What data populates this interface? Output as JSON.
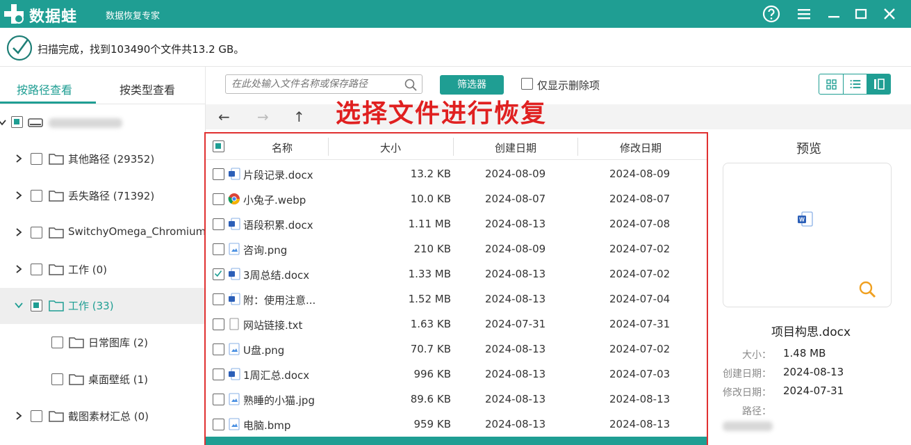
{
  "titlebar": {
    "app_name": "数据蛙",
    "app_subtitle": "数据恢复专家",
    "buttons": [
      "help-icon",
      "menu-icon",
      "minimize-icon",
      "maximize-icon",
      "close-icon"
    ]
  },
  "status": {
    "text": "扫描完成，找到103490个文件共13.2 GB。"
  },
  "left_tabs": {
    "by_path": "按路径查看",
    "by_type": "按类型查看"
  },
  "tree": [
    {
      "label": "其他路径 (29352)"
    },
    {
      "label": "丢失路径 (71392)"
    },
    {
      "label": "SwitchyOmega_Chromium"
    },
    {
      "label": "工作 (0)"
    },
    {
      "label": "工作 (33)"
    },
    {
      "label": "日常图库 (2)"
    },
    {
      "label": "桌面壁纸 (1)"
    },
    {
      "label": "截图素材汇总 (0)"
    }
  ],
  "toolbar": {
    "search_placeholder": "在此处输入文件名称或保存路径",
    "filter_label": "筛选器",
    "only_deleted_label": "仅显示删除项"
  },
  "annotation": "选择文件进行恢复",
  "table": {
    "headers": [
      "名称",
      "大小",
      "创建日期",
      "修改日期"
    ],
    "rows": [
      {
        "name": "片段记录.docx",
        "size": "13.2 KB",
        "created": "2024-08-09",
        "modified": "2024-08-09",
        "icon": "docx",
        "checked": false
      },
      {
        "name": "小兔子.webp",
        "size": "10.0 KB",
        "created": "2024-08-07",
        "modified": "2024-08-07",
        "icon": "chrome",
        "checked": false
      },
      {
        "name": "语段积累.docx",
        "size": "1.11 MB",
        "created": "2024-08-13",
        "modified": "2024-07-08",
        "icon": "docx",
        "checked": false
      },
      {
        "name": "咨询.png",
        "size": "210 KB",
        "created": "2024-08-09",
        "modified": "2024-07-02",
        "icon": "image",
        "checked": false
      },
      {
        "name": "3周总结.docx",
        "size": "1.33 MB",
        "created": "2024-08-13",
        "modified": "2024-07-02",
        "icon": "docx",
        "checked": true
      },
      {
        "name": "附：使用注意...",
        "size": "1.52 MB",
        "created": "2024-08-13",
        "modified": "2024-07-04",
        "icon": "docx",
        "checked": false
      },
      {
        "name": "网站链接.txt",
        "size": "1.63 KB",
        "created": "2024-07-31",
        "modified": "2024-07-31",
        "icon": "txt",
        "checked": false
      },
      {
        "name": "U盘.png",
        "size": "70.7 KB",
        "created": "2024-08-13",
        "modified": "2024-07-02",
        "icon": "image",
        "checked": false
      },
      {
        "name": "1周汇总.docx",
        "size": "996 KB",
        "created": "2024-08-13",
        "modified": "2024-07-03",
        "icon": "docx",
        "checked": false
      },
      {
        "name": "熟睡的小猫.jpg",
        "size": "89.6 KB",
        "created": "2024-08-13",
        "modified": "2024-08-13",
        "icon": "image",
        "checked": false
      },
      {
        "name": "电脑.bmp",
        "size": "959 KB",
        "created": "2024-08-13",
        "modified": "2024-08-13",
        "icon": "image",
        "checked": false
      }
    ]
  },
  "preview": {
    "title": "预览",
    "file_name": "项目构思.docx",
    "size_label": "大小：",
    "size_value": "1.48 MB",
    "created_label": "创建日期：",
    "created_value": "2024-08-13",
    "modified_label": "修改日期：",
    "modified_value": "2024-07-31",
    "path_label": "路径："
  },
  "colors": {
    "accent": "#1f9e93",
    "annotation": "#e02020"
  }
}
